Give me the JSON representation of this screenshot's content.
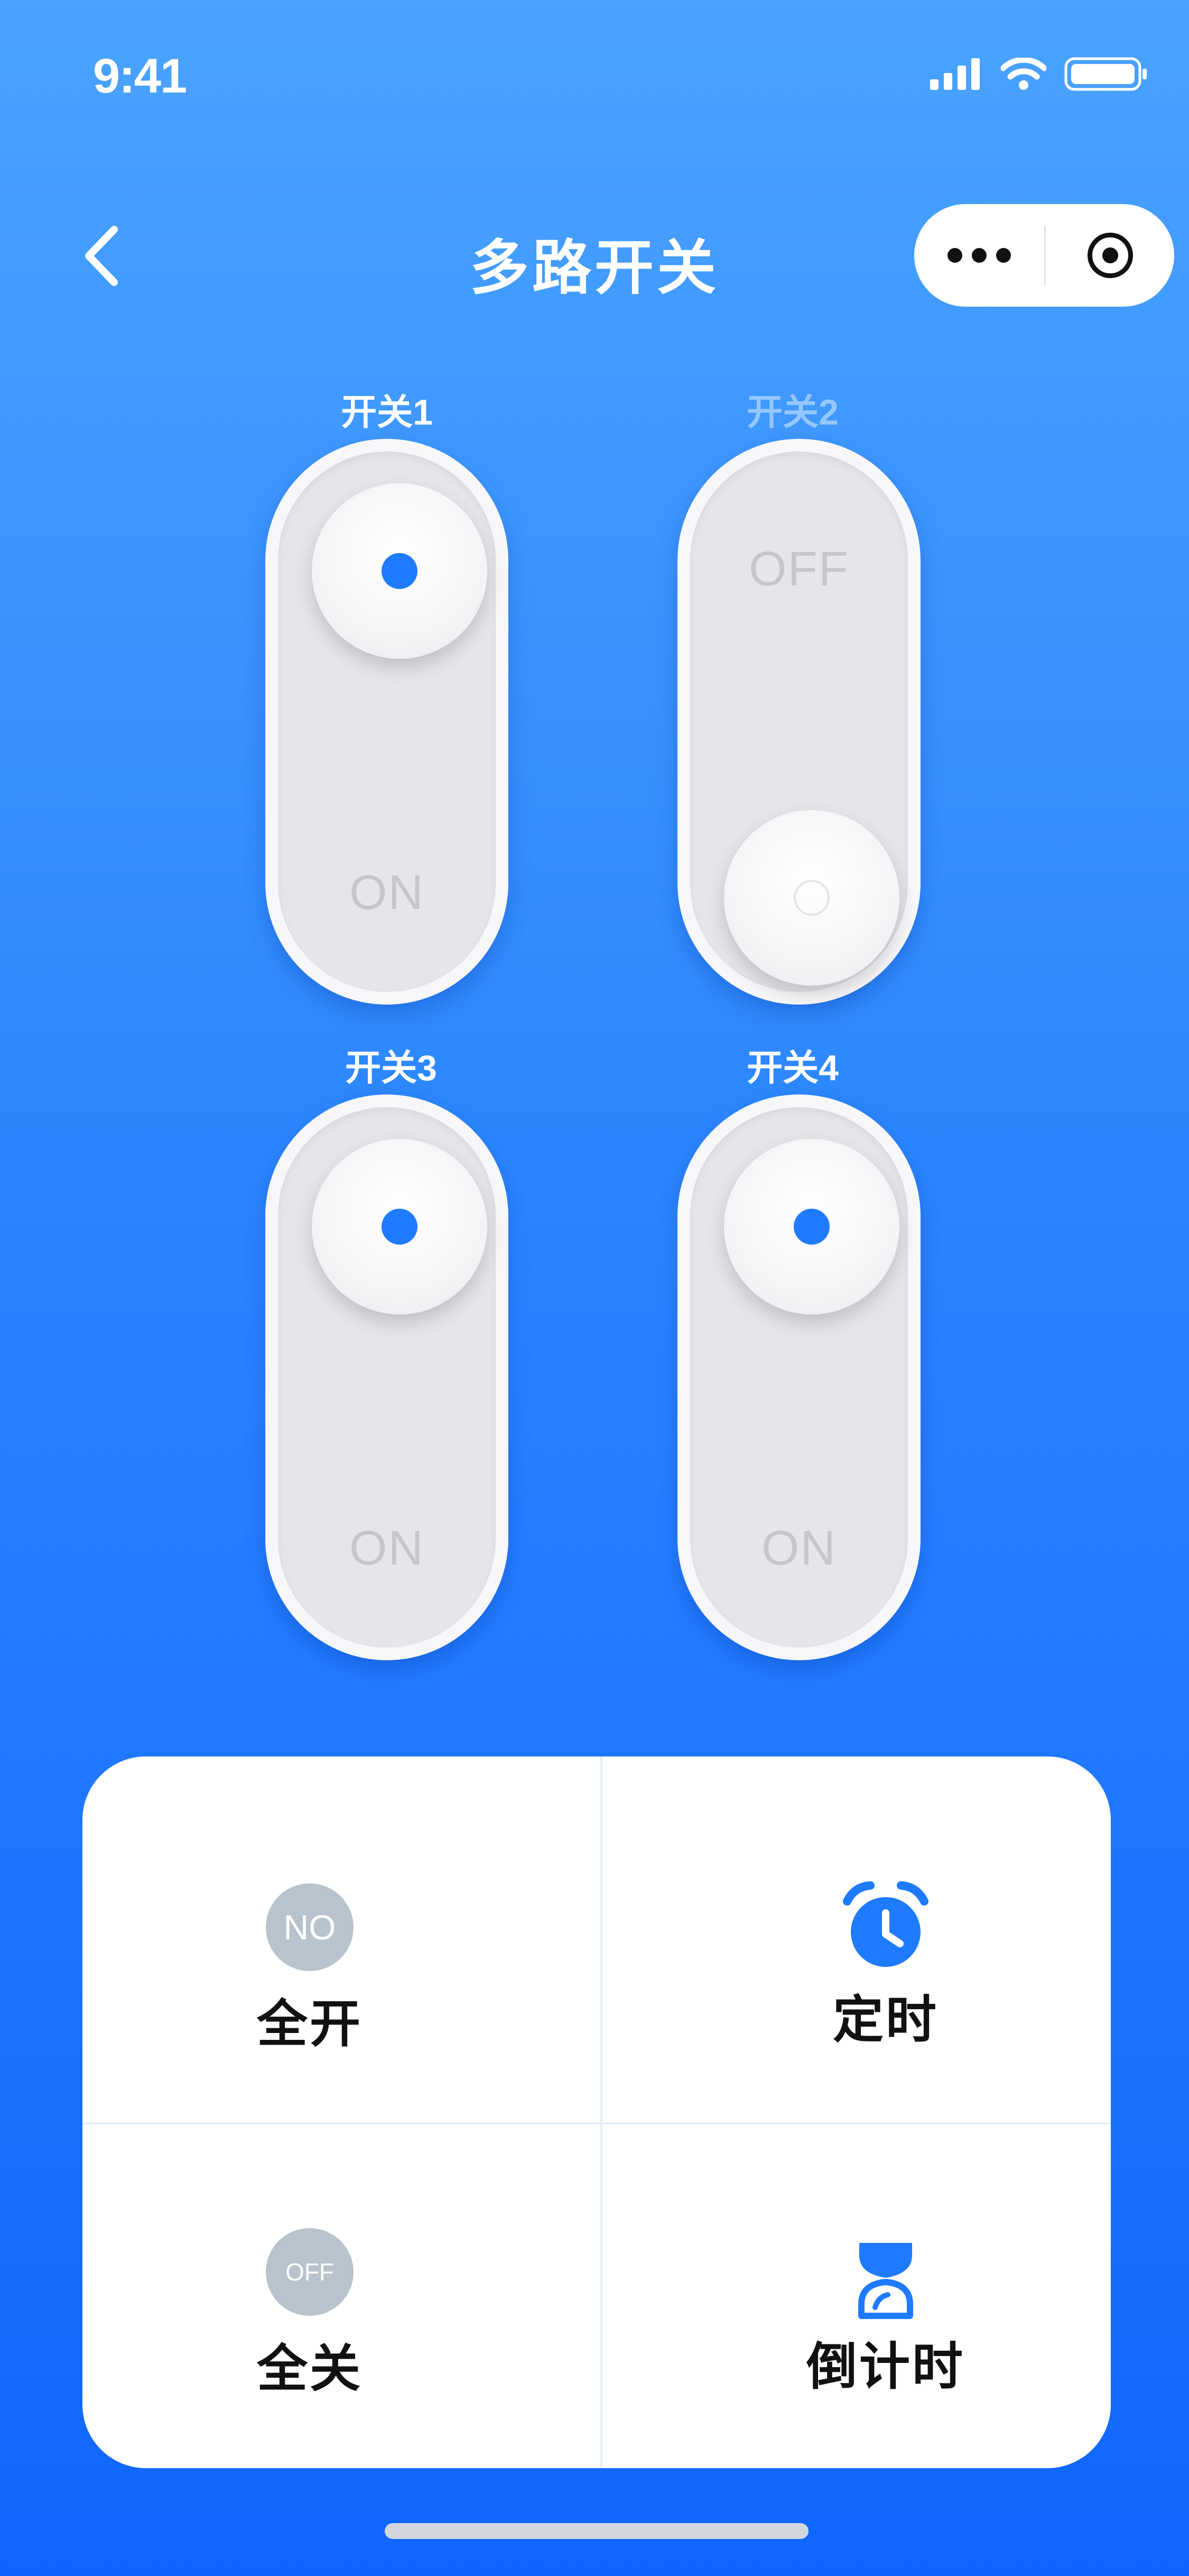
{
  "status_bar": {
    "time": "9:41"
  },
  "nav": {
    "title": "多路开关"
  },
  "switches": [
    {
      "label": "开关1",
      "state_text": "ON",
      "on": true
    },
    {
      "label": "开关2",
      "state_text": "OFF",
      "on": false
    },
    {
      "label": "开关3",
      "state_text": "ON",
      "on": true
    },
    {
      "label": "开关4",
      "state_text": "ON",
      "on": true
    }
  ],
  "controls": {
    "all_on": {
      "badge": "NO",
      "label": "全开"
    },
    "timer": {
      "label": "定时"
    },
    "all_off": {
      "badge": "OFF",
      "label": "全关"
    },
    "countdown": {
      "label": "倒计时"
    }
  },
  "colors": {
    "accent": "#1e7bff",
    "badge_gray": "#b8c3cd",
    "background_top": "#4aa3ff",
    "background_bottom": "#0f66ff"
  },
  "icons": {
    "back": "chevron-left-icon",
    "more": "more-dots-icon",
    "target": "target-icon",
    "timer": "alarm-clock-icon",
    "countdown": "hourglass-icon"
  }
}
